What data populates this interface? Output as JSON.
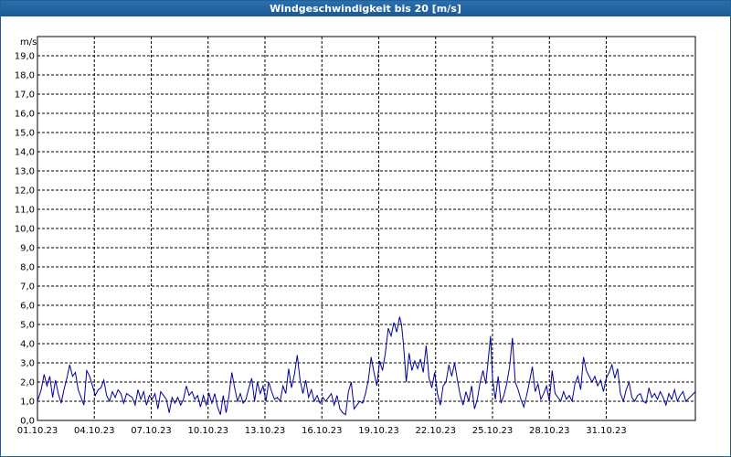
{
  "window": {
    "title": "Windgeschwindigkeit bis 20 [m/s]"
  },
  "chart_data": {
    "type": "line",
    "title": "Windgeschwindigkeit bis 20 [m/s]",
    "ylabel": "m/s",
    "ylim": [
      0,
      20
    ],
    "xlim_days": [
      0,
      34.7
    ],
    "grid": true,
    "y_ticks": [
      "0,0",
      "1,0",
      "2,0",
      "3,0",
      "4,0",
      "5,0",
      "6,0",
      "7,0",
      "8,0",
      "9,0",
      "10,0",
      "11,0",
      "12,0",
      "13,0",
      "14,0",
      "15,0",
      "16,0",
      "17,0",
      "18,0",
      "19,0"
    ],
    "x_ticks": [
      "01.10.23",
      "04.10.23",
      "07.10.23",
      "10.10.23",
      "13.10.23",
      "16.10.23",
      "19.10.23",
      "22.10.23",
      "25.10.23",
      "28.10.23",
      "31.10.23"
    ],
    "line_color": "#00009c",
    "series": [
      {
        "values": [
          [
            0.0,
            1.0
          ],
          [
            0.2,
            1.6
          ],
          [
            0.35,
            2.4
          ],
          [
            0.5,
            1.8
          ],
          [
            0.65,
            2.3
          ],
          [
            0.8,
            1.2
          ],
          [
            0.95,
            2.1
          ],
          [
            1.1,
            1.4
          ],
          [
            1.25,
            0.9
          ],
          [
            1.4,
            1.6
          ],
          [
            1.55,
            2.2
          ],
          [
            1.7,
            2.9
          ],
          [
            1.85,
            2.3
          ],
          [
            2.0,
            2.5
          ],
          [
            2.15,
            1.6
          ],
          [
            2.3,
            1.2
          ],
          [
            2.45,
            0.8
          ],
          [
            2.6,
            2.6
          ],
          [
            2.75,
            2.3
          ],
          [
            2.9,
            1.8
          ],
          [
            3.05,
            1.3
          ],
          [
            3.2,
            1.6
          ],
          [
            3.35,
            1.7
          ],
          [
            3.5,
            2.1
          ],
          [
            3.65,
            1.3
          ],
          [
            3.8,
            1.0
          ],
          [
            3.95,
            1.5
          ],
          [
            4.1,
            1.2
          ],
          [
            4.25,
            1.6
          ],
          [
            4.4,
            1.4
          ],
          [
            4.55,
            0.9
          ],
          [
            4.7,
            1.4
          ],
          [
            4.85,
            1.3
          ],
          [
            5.0,
            1.2
          ],
          [
            5.15,
            0.8
          ],
          [
            5.3,
            1.6
          ],
          [
            5.45,
            1.1
          ],
          [
            5.6,
            1.5
          ],
          [
            5.75,
            0.8
          ],
          [
            5.9,
            1.3
          ],
          [
            6.05,
            1.1
          ],
          [
            6.2,
            1.4
          ],
          [
            6.35,
            0.6
          ],
          [
            6.5,
            1.5
          ],
          [
            6.65,
            1.3
          ],
          [
            6.8,
            1.1
          ],
          [
            6.95,
            0.4
          ],
          [
            7.1,
            1.2
          ],
          [
            7.25,
            0.9
          ],
          [
            7.4,
            1.2
          ],
          [
            7.55,
            0.8
          ],
          [
            7.7,
            1.1
          ],
          [
            7.85,
            1.8
          ],
          [
            8.0,
            1.3
          ],
          [
            8.15,
            1.5
          ],
          [
            8.3,
            1.1
          ],
          [
            8.45,
            1.3
          ],
          [
            8.6,
            0.7
          ],
          [
            8.75,
            1.3
          ],
          [
            8.9,
            0.8
          ],
          [
            9.05,
            1.4
          ],
          [
            9.2,
            0.9
          ],
          [
            9.35,
            1.4
          ],
          [
            9.5,
            0.7
          ],
          [
            9.65,
            0.3
          ],
          [
            9.8,
            1.3
          ],
          [
            9.95,
            0.4
          ],
          [
            10.1,
            1.3
          ],
          [
            10.25,
            2.5
          ],
          [
            10.4,
            1.7
          ],
          [
            10.55,
            1.0
          ],
          [
            10.7,
            1.4
          ],
          [
            10.85,
            0.9
          ],
          [
            11.0,
            1.1
          ],
          [
            11.15,
            1.7
          ],
          [
            11.3,
            2.2
          ],
          [
            11.45,
            1.0
          ],
          [
            11.6,
            2.0
          ],
          [
            11.75,
            1.4
          ],
          [
            11.9,
            1.8
          ],
          [
            12.05,
            1.0
          ],
          [
            12.2,
            2.0
          ],
          [
            12.35,
            1.5
          ],
          [
            12.5,
            1.1
          ],
          [
            12.65,
            1.2
          ],
          [
            12.8,
            1.0
          ],
          [
            12.95,
            1.8
          ],
          [
            13.1,
            1.4
          ],
          [
            13.25,
            2.7
          ],
          [
            13.4,
            1.7
          ],
          [
            13.55,
            2.4
          ],
          [
            13.7,
            3.4
          ],
          [
            13.85,
            2.1
          ],
          [
            14.0,
            1.4
          ],
          [
            14.15,
            2.1
          ],
          [
            14.3,
            1.2
          ],
          [
            14.45,
            1.6
          ],
          [
            14.6,
            1.0
          ],
          [
            14.75,
            1.3
          ],
          [
            14.9,
            0.9
          ],
          [
            15.05,
            1.2
          ],
          [
            15.2,
            1.0
          ],
          [
            15.35,
            1.2
          ],
          [
            15.5,
            1.4
          ],
          [
            15.65,
            0.8
          ],
          [
            15.8,
            1.3
          ],
          [
            15.95,
            0.6
          ],
          [
            16.1,
            0.4
          ],
          [
            16.25,
            0.3
          ],
          [
            16.4,
            1.5
          ],
          [
            16.55,
            2.0
          ],
          [
            16.7,
            0.6
          ],
          [
            16.85,
            0.8
          ],
          [
            17.0,
            1.0
          ],
          [
            17.15,
            0.9
          ],
          [
            17.3,
            1.4
          ],
          [
            17.45,
            2.1
          ],
          [
            17.6,
            3.3
          ],
          [
            17.75,
            2.5
          ],
          [
            17.9,
            1.8
          ],
          [
            18.05,
            3.1
          ],
          [
            18.2,
            2.6
          ],
          [
            18.35,
            3.5
          ],
          [
            18.5,
            4.8
          ],
          [
            18.65,
            4.4
          ],
          [
            18.8,
            5.1
          ],
          [
            18.95,
            4.6
          ],
          [
            19.1,
            5.4
          ],
          [
            19.2,
            5.0
          ],
          [
            19.3,
            4.0
          ],
          [
            19.45,
            2.0
          ],
          [
            19.6,
            3.5
          ],
          [
            19.75,
            2.6
          ],
          [
            19.9,
            3.1
          ],
          [
            20.05,
            2.7
          ],
          [
            20.2,
            3.2
          ],
          [
            20.35,
            2.5
          ],
          [
            20.5,
            3.9
          ],
          [
            20.65,
            2.2
          ],
          [
            20.8,
            1.7
          ],
          [
            20.95,
            2.5
          ],
          [
            21.1,
            1.4
          ],
          [
            21.25,
            0.8
          ],
          [
            21.4,
            1.8
          ],
          [
            21.55,
            2.0
          ],
          [
            21.7,
            2.9
          ],
          [
            21.85,
            2.3
          ],
          [
            22.0,
            3.0
          ],
          [
            22.15,
            2.1
          ],
          [
            22.3,
            1.3
          ],
          [
            22.45,
            0.8
          ],
          [
            22.6,
            1.5
          ],
          [
            22.75,
            1.0
          ],
          [
            22.9,
            1.8
          ],
          [
            23.05,
            0.6
          ],
          [
            23.2,
            1.1
          ],
          [
            23.35,
            2.0
          ],
          [
            23.5,
            2.6
          ],
          [
            23.65,
            1.9
          ],
          [
            23.8,
            3.4
          ],
          [
            23.9,
            4.4
          ],
          [
            24.0,
            2.2
          ],
          [
            24.15,
            1.1
          ],
          [
            24.3,
            2.3
          ],
          [
            24.45,
            0.9
          ],
          [
            24.6,
            1.3
          ],
          [
            24.75,
            1.9
          ],
          [
            24.9,
            2.8
          ],
          [
            25.05,
            4.3
          ],
          [
            25.2,
            2.0
          ],
          [
            25.35,
            1.6
          ],
          [
            25.5,
            1.1
          ],
          [
            25.65,
            0.7
          ],
          [
            25.8,
            1.3
          ],
          [
            25.95,
            2.0
          ],
          [
            26.1,
            2.8
          ],
          [
            26.25,
            1.5
          ],
          [
            26.4,
            1.9
          ],
          [
            26.55,
            1.1
          ],
          [
            26.7,
            1.4
          ],
          [
            26.85,
            1.8
          ],
          [
            27.0,
            1.0
          ],
          [
            27.15,
            2.6
          ],
          [
            27.3,
            1.4
          ],
          [
            27.45,
            1.2
          ],
          [
            27.6,
            1.0
          ],
          [
            27.75,
            1.5
          ],
          [
            27.9,
            1.1
          ],
          [
            28.05,
            1.3
          ],
          [
            28.2,
            1.0
          ],
          [
            28.35,
            1.9
          ],
          [
            28.5,
            2.3
          ],
          [
            28.65,
            1.6
          ],
          [
            28.8,
            3.3
          ],
          [
            28.95,
            2.6
          ],
          [
            29.1,
            2.3
          ],
          [
            29.25,
            2.0
          ],
          [
            29.4,
            2.3
          ],
          [
            29.55,
            1.8
          ],
          [
            29.7,
            2.1
          ],
          [
            29.85,
            1.5
          ],
          [
            30.0,
            2.2
          ],
          [
            30.15,
            2.5
          ],
          [
            30.3,
            2.9
          ],
          [
            30.45,
            2.2
          ],
          [
            30.6,
            2.7
          ],
          [
            30.75,
            1.4
          ],
          [
            30.9,
            1.0
          ],
          [
            31.05,
            1.6
          ],
          [
            31.2,
            2.0
          ],
          [
            31.35,
            1.2
          ],
          [
            31.5,
            1.0
          ],
          [
            31.65,
            1.3
          ],
          [
            31.8,
            1.4
          ],
          [
            31.95,
            1.0
          ],
          [
            32.1,
            0.9
          ],
          [
            32.25,
            1.7
          ],
          [
            32.4,
            1.2
          ],
          [
            32.55,
            1.4
          ],
          [
            32.7,
            1.1
          ],
          [
            32.85,
            1.5
          ],
          [
            33.0,
            1.2
          ],
          [
            33.15,
            0.8
          ],
          [
            33.3,
            1.4
          ],
          [
            33.45,
            1.1
          ],
          [
            33.6,
            1.6
          ],
          [
            33.75,
            1.0
          ],
          [
            33.9,
            1.3
          ],
          [
            34.05,
            1.5
          ],
          [
            34.2,
            1.0
          ],
          [
            34.4,
            1.2
          ],
          [
            34.7,
            1.5
          ]
        ]
      }
    ]
  }
}
